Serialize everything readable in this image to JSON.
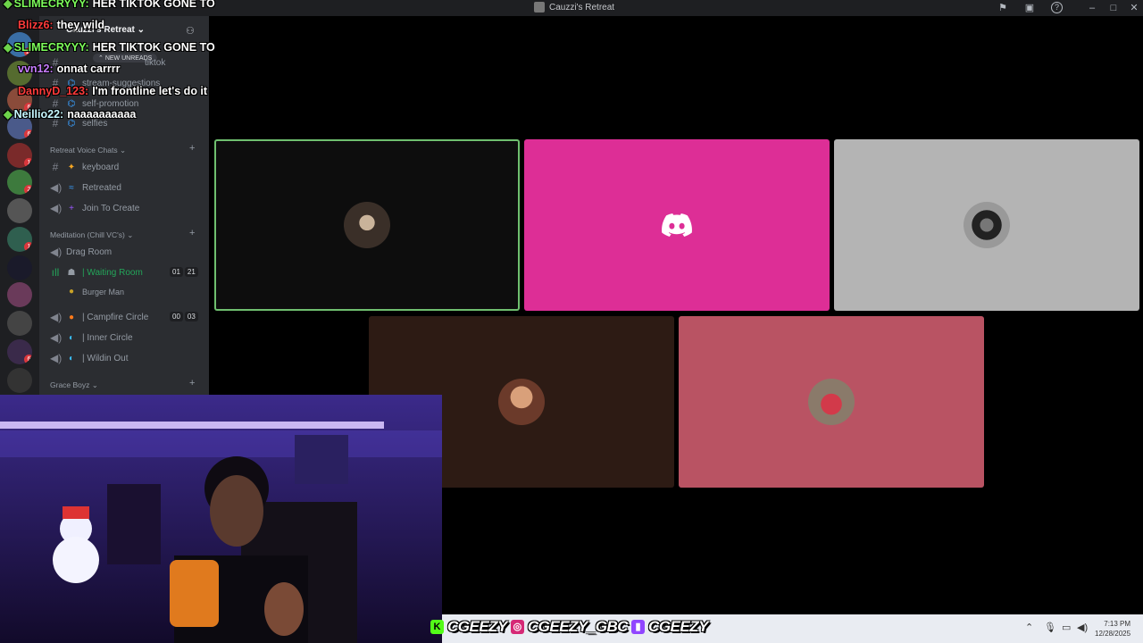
{
  "window": {
    "title": "Cauzzi's Retreat"
  },
  "server": {
    "name": "Cauzzi's Retreat",
    "new_unreads": "NEW UNREADS"
  },
  "text_channels": [
    {
      "name": "tiktok"
    },
    {
      "name": "stream-suggestions"
    },
    {
      "name": "self-promotion"
    },
    {
      "name": "selfies"
    }
  ],
  "categories": {
    "retreat_voice": "Retreat Voice Chats",
    "meditation": "Meditation (Chill VC's)",
    "grace_boyz": "Grace Boyz"
  },
  "voice_channels": {
    "keyboard": "keyboard",
    "retreated": "Retreated",
    "join_to_create": "Join To Create",
    "drag_room": "Drag Room",
    "waiting_room": "| Waiting Room",
    "waiting_room_counts": [
      "01",
      "21"
    ],
    "member": "Burger Man",
    "campfire_circle": "| Campfire Circle",
    "campfire_counts": [
      "00",
      "03"
    ],
    "inner_circle": "| Inner Circle",
    "wildin_out": "| Wildin Out"
  },
  "server_badges": [
    "15",
    "6",
    "6",
    "1",
    "2",
    "1",
    "6"
  ],
  "chat_overlay": [
    {
      "user": "SLIMECRYYY:",
      "color": "#7CFC5A",
      "message": "HER TIKTOK GONE TO"
    },
    {
      "user": "Blizz6:",
      "color": "#ff3b3b",
      "message": "they wild"
    },
    {
      "user": "SLIMECRYYY:",
      "color": "#7CFC5A",
      "message": "HER TIKTOK GONE TO"
    },
    {
      "user": "vvn12:",
      "color": "#c77dff",
      "message": "onnat carrrr"
    },
    {
      "user": "DannyD_123:",
      "color": "#ff3b3b",
      "message": "I'm frontline let's do it"
    },
    {
      "user": "Neillio22:",
      "color": "#c6f7ff",
      "message": "naaaaaaaaaa"
    }
  ],
  "video_tiles": [
    {
      "bg": "#0d0d0d",
      "speaking": true
    },
    {
      "bg": "#dd2e96",
      "speaking": false,
      "icon": "discord-logo-icon"
    },
    {
      "bg": "#b4b4b4",
      "speaking": false
    },
    {
      "bg": "#2d1b14",
      "speaking": false
    },
    {
      "bg": "#b95363",
      "speaking": false
    }
  ],
  "socials": [
    {
      "platform": "kick-icon",
      "handle": "CGEEZY",
      "color": "#53fc18"
    },
    {
      "platform": "instagram-icon",
      "handle": "CGEEZY_GBC",
      "color": "#d62976"
    },
    {
      "platform": "twitch-icon",
      "handle": "CGEEZY",
      "color": "#9146ff"
    }
  ],
  "clock": {
    "time": "7:13 PM",
    "date": "12/28/2025"
  }
}
